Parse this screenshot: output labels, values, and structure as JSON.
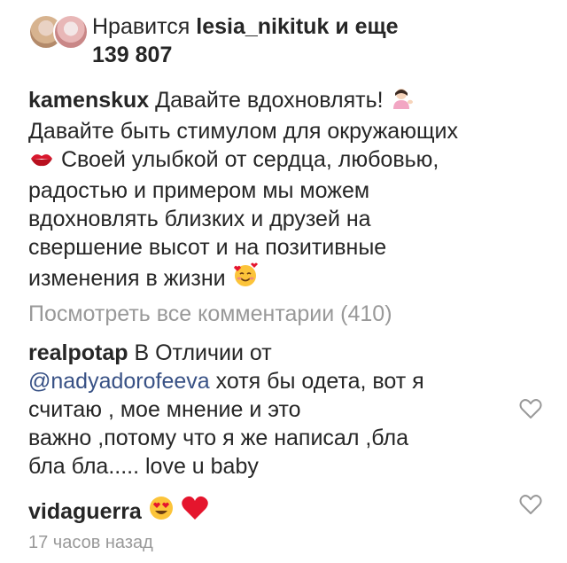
{
  "likes": {
    "prefix": "Нравится",
    "user": "lesia_nikituk",
    "middle": "и еще",
    "count": "139 807"
  },
  "caption": {
    "username": "kamenskux",
    "line1": "Давайте вдохновлять!",
    "line2": "Давайте быть стимулом для окружающих",
    "line3": "Своей улыбкой от сердца, любовью,",
    "line4": "радостью и примером мы можем",
    "line5": "вдохновлять близких и друзей на",
    "line6": "свершение высот и на позитивные",
    "line7": "изменения в жизни"
  },
  "view_all_comments": "Посмотреть все комментарии (410)",
  "comments": [
    {
      "username": "realpotap",
      "text_a": "В Отличии от",
      "mention": "@nadyadorofeeva",
      "text_b": "хотя бы одета, вот я",
      "text_c": "считаю , мое мнение и это",
      "text_d": "важно ,потому что я же написал ,бла",
      "text_e": "бла бла..... love u baby"
    },
    {
      "username": "vidaguerra"
    }
  ],
  "timestamp": "17 часов назад",
  "icons": {
    "like": "heart-outline-icon"
  },
  "colors": {
    "text": "#262626",
    "secondary": "#999999",
    "link": "#385185",
    "heart": "#e5152d"
  }
}
